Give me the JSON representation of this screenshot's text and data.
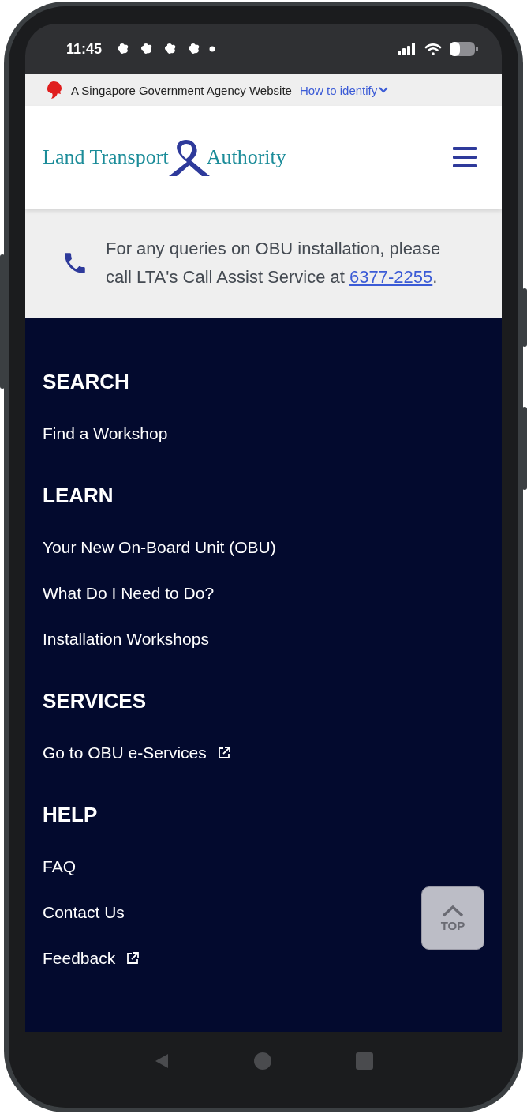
{
  "status_bar": {
    "time": "11:45"
  },
  "gov_banner": {
    "text": "A Singapore Government Agency Website",
    "link": "How to identify"
  },
  "header": {
    "logo_left": "Land Transport",
    "logo_right": "Authority"
  },
  "notice": {
    "text": "For any queries on OBU installation, please call LTA's Call Assist Service at ",
    "phone": "6377-2255",
    "after": "."
  },
  "footer": [
    {
      "heading": "SEARCH",
      "links": [
        {
          "label": "Find a Workshop",
          "external": false
        }
      ]
    },
    {
      "heading": "LEARN",
      "links": [
        {
          "label": "Your New On-Board Unit (OBU)",
          "external": false
        },
        {
          "label": "What Do I Need to Do?",
          "external": false
        },
        {
          "label": "Installation Workshops",
          "external": false
        }
      ]
    },
    {
      "heading": "SERVICES",
      "links": [
        {
          "label": "Go to OBU e-Services",
          "external": true
        }
      ]
    },
    {
      "heading": "HELP",
      "links": [
        {
          "label": "FAQ",
          "external": false
        },
        {
          "label": "Contact Us",
          "external": false
        },
        {
          "label": "Feedback",
          "external": true
        }
      ]
    }
  ],
  "back_to_top": {
    "label": "TOP"
  }
}
